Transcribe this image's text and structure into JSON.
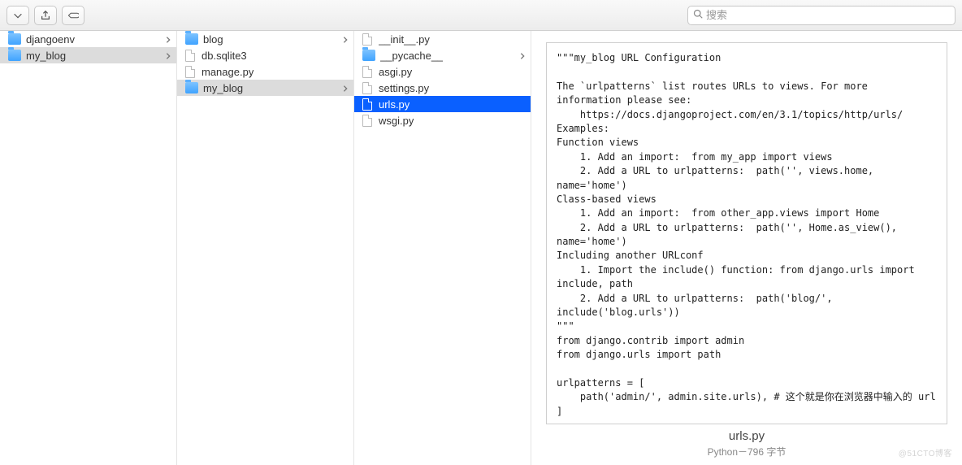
{
  "toolbar": {
    "search_placeholder": "搜索"
  },
  "columns": [
    {
      "items": [
        {
          "name": "djangoenv",
          "kind": "folder",
          "selected": false,
          "has_children": true
        },
        {
          "name": "my_blog",
          "kind": "folder",
          "selected": "grey",
          "has_children": true
        }
      ]
    },
    {
      "items": [
        {
          "name": "blog",
          "kind": "folder",
          "selected": false,
          "has_children": true
        },
        {
          "name": "db.sqlite3",
          "kind": "file",
          "selected": false,
          "has_children": false
        },
        {
          "name": "manage.py",
          "kind": "file",
          "selected": false,
          "has_children": false
        },
        {
          "name": "my_blog",
          "kind": "folder",
          "selected": "grey",
          "has_children": true
        }
      ]
    },
    {
      "items": [
        {
          "name": "__init__.py",
          "kind": "file",
          "selected": false,
          "has_children": false
        },
        {
          "name": "__pycache__",
          "kind": "folder",
          "selected": false,
          "has_children": true
        },
        {
          "name": "asgi.py",
          "kind": "file",
          "selected": false,
          "has_children": false
        },
        {
          "name": "settings.py",
          "kind": "file",
          "selected": false,
          "has_children": false
        },
        {
          "name": "urls.py",
          "kind": "file",
          "selected": "blue",
          "has_children": false
        },
        {
          "name": "wsgi.py",
          "kind": "file",
          "selected": false,
          "has_children": false
        }
      ]
    }
  ],
  "preview": {
    "filename": "urls.py",
    "meta_line": "Python－796 字节",
    "content": "\"\"\"my_blog URL Configuration\n\nThe `urlpatterns` list routes URLs to views. For more information please see:\n    https://docs.djangoproject.com/en/3.1/topics/http/urls/\nExamples:\nFunction views\n    1. Add an import:  from my_app import views\n    2. Add a URL to urlpatterns:  path('', views.home, name='home')\nClass-based views\n    1. Add an import:  from other_app.views import Home\n    2. Add a URL to urlpatterns:  path('', Home.as_view(), name='home')\nIncluding another URLconf\n    1. Import the include() function: from django.urls import include, path\n    2. Add a URL to urlpatterns:  path('blog/', include('blog.urls'))\n\"\"\"\nfrom django.contrib import admin\nfrom django.urls import path\n\nurlpatterns = [\n    path('admin/', admin.site.urls), # 这个就是你在浏览器中输入的 url\n]"
  },
  "watermark": "@51CTO博客"
}
